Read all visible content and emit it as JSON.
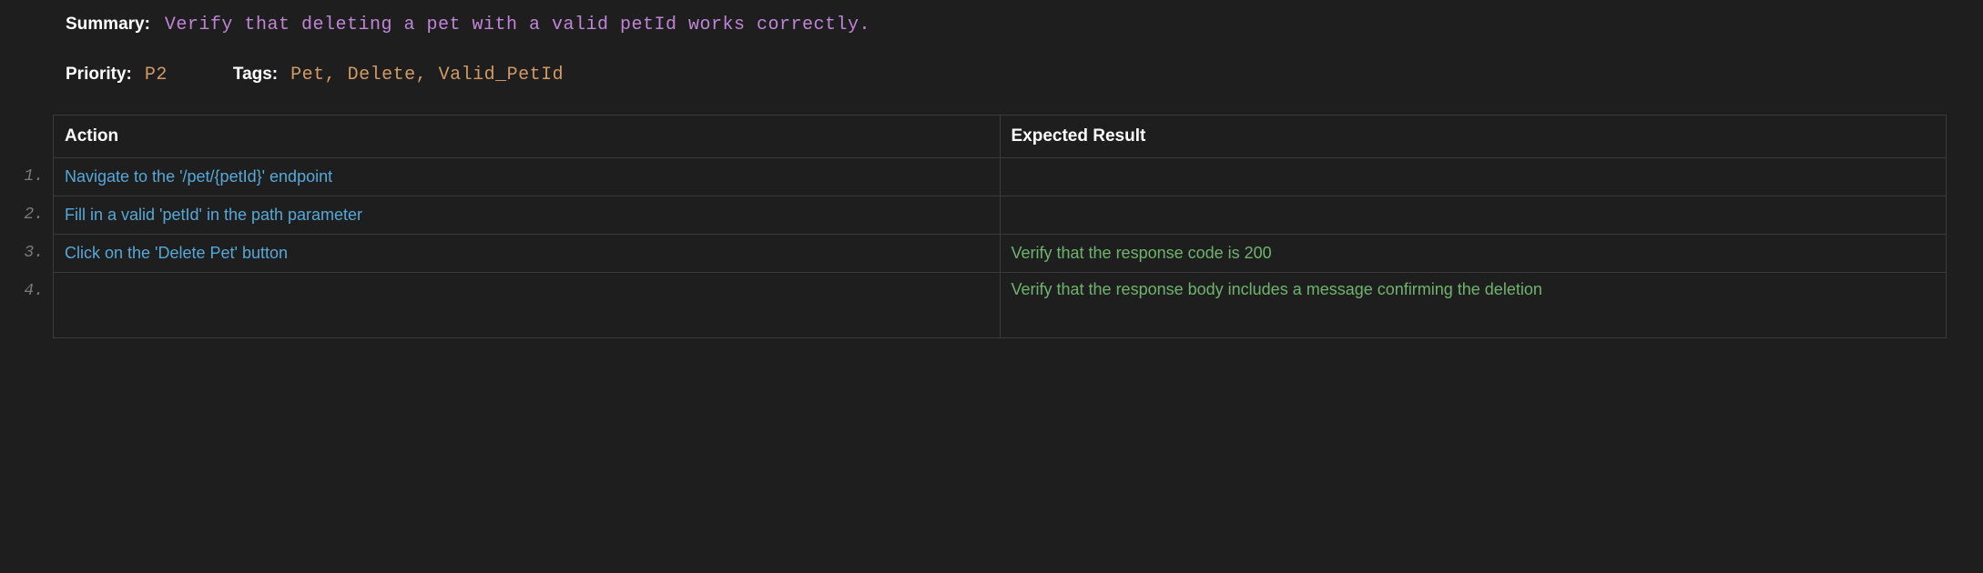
{
  "summary": {
    "label": "Summary:",
    "value": "Verify that deleting a pet with a valid petId works correctly."
  },
  "priority": {
    "label": "Priority:",
    "value": "P2"
  },
  "tags": {
    "label": "Tags:",
    "value": "Pet, Delete, Valid_PetId"
  },
  "table": {
    "header_action": "Action",
    "header_expected": "Expected Result",
    "rows": [
      {
        "num": "1.",
        "action": "Navigate to the '/pet/{petId}' endpoint",
        "expected": ""
      },
      {
        "num": "2.",
        "action": "Fill in a valid 'petId' in the path parameter",
        "expected": ""
      },
      {
        "num": "3.",
        "action": "Click on the 'Delete Pet' button",
        "expected": "Verify that the response code is 200"
      },
      {
        "num": "4.",
        "action": "",
        "expected": "Verify that the response body includes a message confirming the deletion"
      }
    ]
  }
}
